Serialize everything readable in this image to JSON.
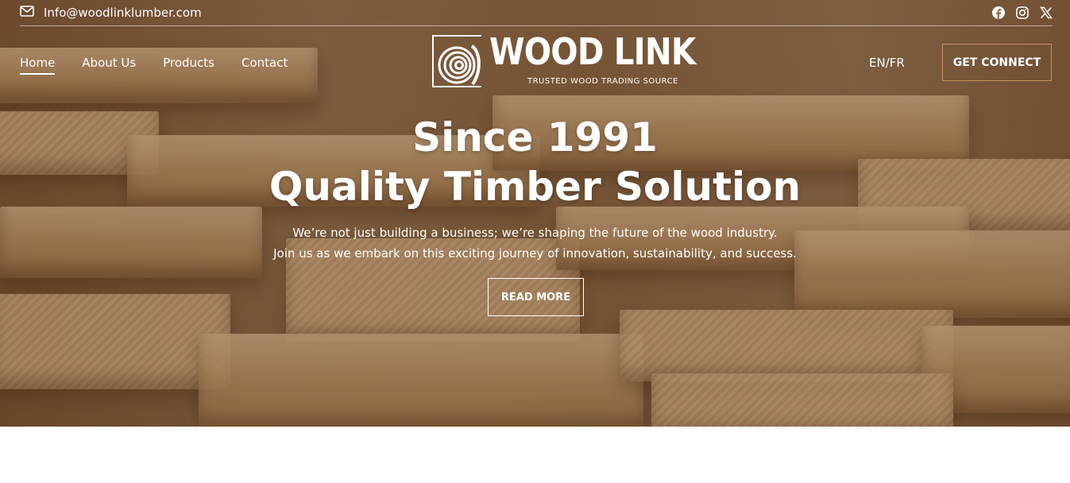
{
  "topbar": {
    "email": "Info@woodlinklumber.com",
    "social_icons": [
      "facebook-icon",
      "instagram-icon",
      "x-icon"
    ]
  },
  "nav": {
    "items": [
      {
        "label": "Home",
        "active": true
      },
      {
        "label": "About Us",
        "active": false
      },
      {
        "label": "Products",
        "active": false
      },
      {
        "label": "Contact",
        "active": false
      }
    ]
  },
  "logo": {
    "name": "WOOD LINK",
    "tagline": "TRUSTED WOOD TRADING SOURCE"
  },
  "header": {
    "language": "EN/FR",
    "cta_label": "GET CONNECT"
  },
  "hero": {
    "line1": "Since 1991",
    "line2": "Quality Timber Solution",
    "sub1": "We’re not just building a business; we’re shaping the future of the wood industry.",
    "sub2": "Join us as we embark on this exciting journey of innovation, sustainability, and success.",
    "button_label": "READ MORE"
  },
  "colors": {
    "cta_border": "#c4935a",
    "text": "#ffffff"
  }
}
